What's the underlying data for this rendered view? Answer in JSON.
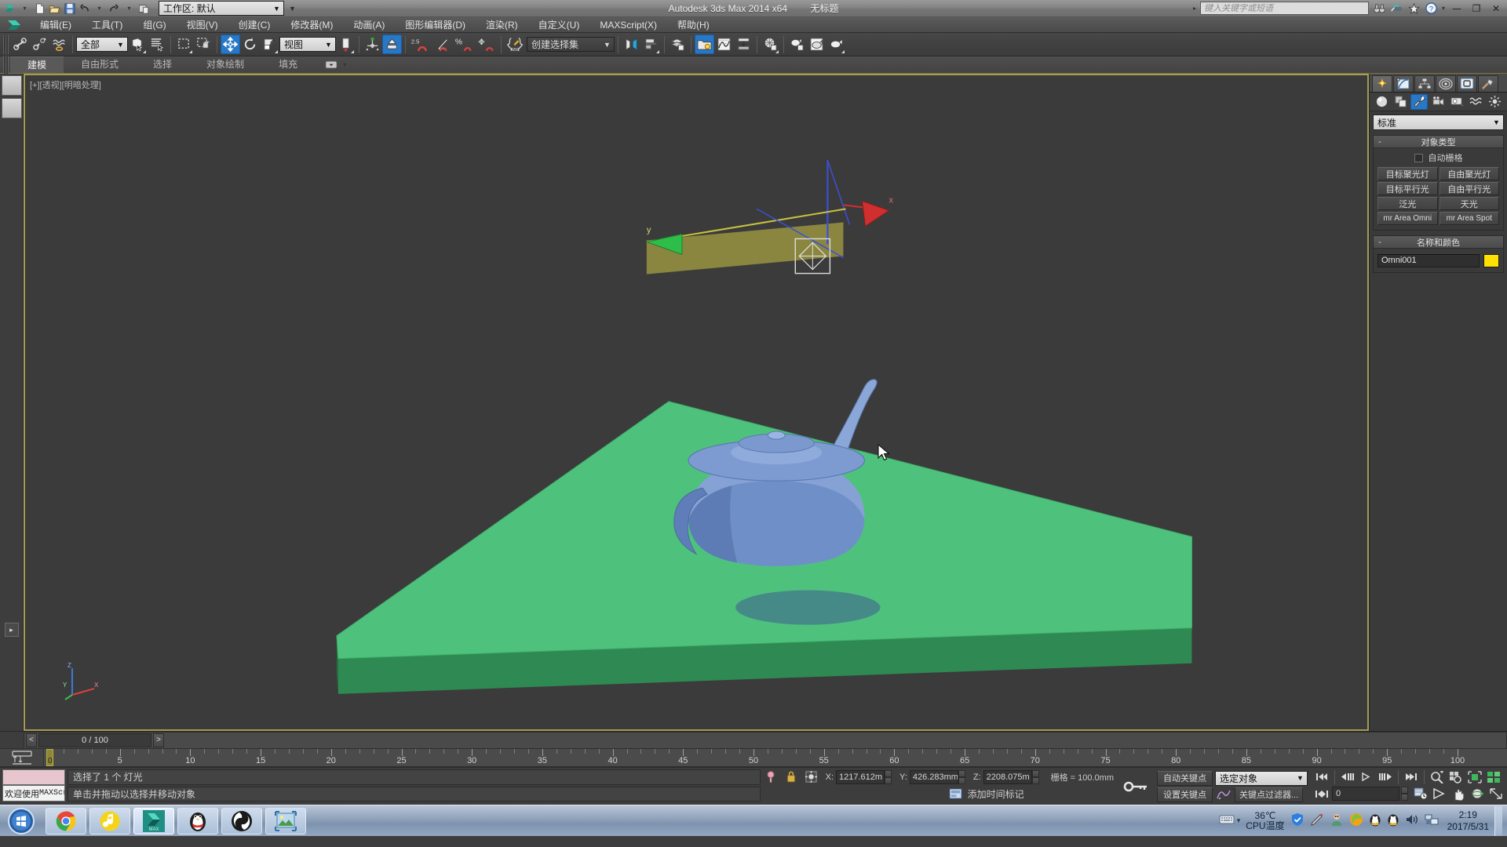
{
  "titlebar": {
    "app_title": "Autodesk 3ds Max  2014 x64",
    "document_title": "无标题",
    "search_placeholder": "键入关键字或短语",
    "quick_icons": [
      "new-icon",
      "open-icon",
      "save-icon",
      "undo-icon",
      "redo-icon",
      "set-project-icon"
    ],
    "workspace_combo": "工作区: 默认",
    "minimize_label": "—",
    "maximize_label": "❐",
    "close_label": "✕",
    "help_label": "?"
  },
  "menubar": {
    "items": [
      {
        "label": "编辑(E)",
        "name": "menu-edit"
      },
      {
        "label": "工具(T)",
        "name": "menu-tools"
      },
      {
        "label": "组(G)",
        "name": "menu-group"
      },
      {
        "label": "视图(V)",
        "name": "menu-views"
      },
      {
        "label": "创建(C)",
        "name": "menu-create"
      },
      {
        "label": "修改器(M)",
        "name": "menu-modifiers"
      },
      {
        "label": "动画(A)",
        "name": "menu-animation"
      },
      {
        "label": "图形编辑器(D)",
        "name": "menu-graph-editors"
      },
      {
        "label": "渲染(R)",
        "name": "menu-rendering"
      },
      {
        "label": "自定义(U)",
        "name": "menu-customize"
      },
      {
        "label": "MAXScript(X)",
        "name": "menu-maxscript"
      },
      {
        "label": "帮助(H)",
        "name": "menu-help"
      }
    ]
  },
  "toolbar": {
    "selection_filter": "全部",
    "reference_coord": "视图",
    "named_selection_sets": "创建选择集",
    "angle_snap_value": "2.5",
    "percent_label": "%",
    "buttons": [
      "select-link-icon",
      "unlink-icon",
      "bind-space-warp-icon",
      "select-object-icon",
      "select-by-name-icon",
      "rect-select-region-icon",
      "window-crossing-icon",
      "select-move-icon",
      "select-rotate-icon",
      "select-scale-icon",
      "mirror-icon",
      "align-icon",
      "snap-toggle-icon",
      "angle-snap-icon",
      "percent-snap-icon",
      "spinner-snap-icon",
      "edit-named-selections-icon",
      "layer-manager-icon",
      "curve-editor-icon",
      "schematic-view-icon",
      "material-editor-icon",
      "render-setup-icon",
      "rendered-frame-window-icon",
      "render-production-icon"
    ]
  },
  "ribbon": {
    "tabs": [
      {
        "label": "建模",
        "name": "ribbon-tab-modeling",
        "active": true
      },
      {
        "label": "自由形式",
        "name": "ribbon-tab-freeform",
        "active": false
      },
      {
        "label": "选择",
        "name": "ribbon-tab-selection",
        "active": false
      },
      {
        "label": "对象绘制",
        "name": "ribbon-tab-object-paint",
        "active": false
      },
      {
        "label": "填充",
        "name": "ribbon-tab-populate",
        "active": false
      }
    ],
    "minimize_icon": "ribbon-minimize-icon"
  },
  "viewport": {
    "label": "[+][透视][明暗处理]",
    "axis_x": "X",
    "axis_y": "Y",
    "axis_z": "Z",
    "gizmo_x_label": "x",
    "gizmo_y_label": "y",
    "ground_color": "#4ec27c",
    "ground_side_color": "#2e8a52",
    "teapot_color": "#6f8fc9",
    "background_color": "#3b3b3b",
    "border_color": "#a49b55"
  },
  "command_panel": {
    "tabs": [
      {
        "name": "cp-tab-create",
        "icon": "create-star-icon",
        "active": true
      },
      {
        "name": "cp-tab-modify",
        "icon": "modify-curve-icon",
        "active": false
      },
      {
        "name": "cp-tab-hierarchy",
        "icon": "hierarchy-icon",
        "active": false
      },
      {
        "name": "cp-tab-motion",
        "icon": "motion-icon",
        "active": false
      },
      {
        "name": "cp-tab-display",
        "icon": "display-monitor-icon",
        "active": false
      },
      {
        "name": "cp-tab-utilities",
        "icon": "utilities-hammer-icon",
        "active": false
      }
    ],
    "category_buttons": [
      {
        "name": "cat-geometry",
        "icon": "sphere-icon",
        "active": false
      },
      {
        "name": "cat-shapes",
        "icon": "shapes-icon",
        "active": false
      },
      {
        "name": "cat-lights",
        "icon": "light-icon",
        "active": true
      },
      {
        "name": "cat-cameras",
        "icon": "camera-icon",
        "active": false
      },
      {
        "name": "cat-helpers",
        "icon": "tape-helper-icon",
        "active": false
      },
      {
        "name": "cat-space-warps",
        "icon": "wave-icon",
        "active": false
      },
      {
        "name": "cat-systems",
        "icon": "systems-icon",
        "active": false
      }
    ],
    "type_dropdown": "标准",
    "object_type": {
      "header": "对象类型",
      "autogrid_label": "自动栅格",
      "autogrid_checked": false,
      "buttons": [
        "目标聚光灯",
        "自由聚光灯",
        "目标平行光",
        "自由平行光",
        "泛光",
        "天光",
        "mr Area Omni",
        "mr Area Spot"
      ]
    },
    "name_and_color": {
      "header": "名称和颜色",
      "object_name": "Omni001",
      "color": "#ffe000"
    }
  },
  "timeline": {
    "frame_field": "0 / 100",
    "prev_label": "<",
    "next_label": ">",
    "ticks": [
      0,
      5,
      10,
      15,
      20,
      25,
      30,
      35,
      40,
      45,
      50,
      55,
      60,
      65,
      70,
      75,
      80,
      85,
      90,
      95,
      100
    ],
    "playhead_frame": "0"
  },
  "statusbar": {
    "maxscript_listener_label": "欢迎使用 ",
    "maxscript_listener_mono": "MAXScri",
    "selection_status": "选择了 1 个 灯光",
    "prompt": "单击并拖动以选择并移动对象",
    "isolate_icon": "isolate-selection-icon",
    "lock_icon": "selection-lock-icon",
    "coords": {
      "x_label": "X:",
      "x_value": "1217.612m",
      "y_label": "Y:",
      "y_value": "426.283mm",
      "z_label": "Z:",
      "z_value": "2208.075m"
    },
    "grid_text": "栅格 = 100.0mm",
    "add_time_tag": "添加时间标记"
  },
  "animation": {
    "key_mode_icon": "key-toggle-icon",
    "auto_key": "自动关键点",
    "set_key": "设置关键点",
    "selection_list": "选定对象",
    "key_filters": "关键点过滤器...",
    "current_frame": "0",
    "transport": [
      "go-to-start-icon",
      "previous-frame-icon",
      "play-icon",
      "next-frame-icon",
      "go-to-end-icon"
    ],
    "key_nav": "key-mode-toggle-icon",
    "time_config_icon": "time-configuration-icon",
    "nav_icons": [
      "zoom-icon",
      "zoom-all-icon",
      "zoom-extents-icon",
      "zoom-region-icon",
      "field-of-view-icon",
      "pan-icon",
      "orbit-icon",
      "maximize-viewport-icon"
    ]
  },
  "taskbar": {
    "start_label": "start-orb-icon",
    "items": [
      {
        "name": "taskbar-chrome",
        "icon": "chrome-icon",
        "active": false
      },
      {
        "name": "taskbar-qqmusic",
        "icon": "qqmusic-icon",
        "active": false
      },
      {
        "name": "taskbar-3dsmax",
        "icon": "3dsmax-icon",
        "active": true
      },
      {
        "name": "taskbar-qq",
        "icon": "qq-penguin-icon",
        "active": false
      },
      {
        "name": "taskbar-obs",
        "icon": "obs-icon",
        "active": false
      },
      {
        "name": "taskbar-photo",
        "icon": "photo-viewer-icon",
        "active": false
      }
    ],
    "tray": {
      "keyboard_icon": "keyboard-icon",
      "expand_icon": "show-hidden-icons-icon",
      "cpu_temp": "36℃",
      "cpu_temp_label": "CPU温度",
      "icons": [
        "shield-icon",
        "pen-icon",
        "doctor-icon",
        "firefox-like-icon",
        "qq-icon-1",
        "qq-icon-2",
        "volume-icon",
        "network-icon"
      ],
      "time": "2:19",
      "date": "2017/5/31"
    }
  }
}
